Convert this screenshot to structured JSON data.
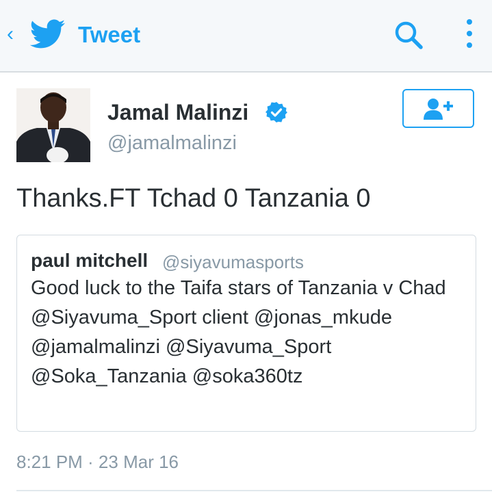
{
  "header": {
    "back_glyph": "‹",
    "title": "Tweet",
    "icons": [
      "back-icon",
      "twitter-bird-icon",
      "search-icon",
      "more-options-icon"
    ]
  },
  "tweet": {
    "author_name": "Jamal Malinzi",
    "author_handle": "@jamalmalinzi",
    "verified": true,
    "text": "Thanks.FT Tchad 0 Tanzania 0",
    "timestamp": "8:21 PM · 23 Mar 16"
  },
  "quoted_tweet": {
    "author_name": "paul mitchell",
    "author_handle": "@siyavumasports",
    "text": "Good luck to the Taifa stars of Tanzania v Chad @Siyavuma_Sport client @jonas_mkude @jamalmalinzi @Siyavuma_Sport @Soka_Tanzania @soka360tz"
  },
  "colors": {
    "accent": "#1da1f2",
    "secondary_text": "#8899a6",
    "primary_text": "#292f33",
    "header_bg": "#f5f8fa"
  }
}
